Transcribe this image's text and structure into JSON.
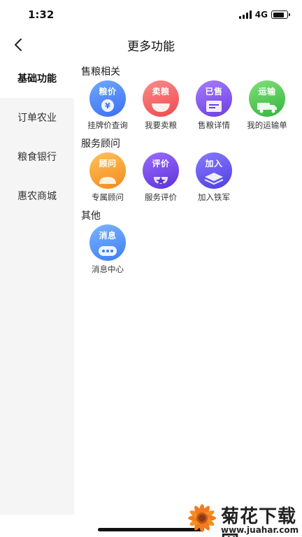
{
  "status": {
    "time": "1:32",
    "network": "4G"
  },
  "nav": {
    "title": "更多功能"
  },
  "sidebar": {
    "items": [
      {
        "label": "基础功能",
        "active": true
      },
      {
        "label": "订单农业",
        "active": false
      },
      {
        "label": "粮食银行",
        "active": false
      },
      {
        "label": "惠农商城",
        "active": false
      }
    ]
  },
  "sections": [
    {
      "title": "售粮相关",
      "items": [
        {
          "tag": "粮价",
          "label": "挂牌价查询",
          "color": "#3b6ff0",
          "icon": "yuan-coin-icon"
        },
        {
          "tag": "卖粮",
          "label": "我要卖粮",
          "color": "#ec4a4f",
          "icon": "grain-bowl-icon"
        },
        {
          "tag": "已售",
          "label": "售粮详情",
          "color": "#6b3fe0",
          "icon": "document-icon"
        },
        {
          "tag": "运输",
          "label": "我的运输单",
          "color": "#34b53d",
          "icon": "truck-icon"
        }
      ]
    },
    {
      "title": "服务顾问",
      "items": [
        {
          "tag": "顾问",
          "label": "专属顾问",
          "color": "#f28a1e",
          "icon": "person-icon"
        },
        {
          "tag": "评价",
          "label": "服务评价",
          "color": "#5d33d6",
          "icon": "star-icon"
        },
        {
          "tag": "加入",
          "label": "加入铁军",
          "color": "#4d3fe0",
          "icon": "layers-icon"
        }
      ]
    },
    {
      "title": "其他",
      "items": [
        {
          "tag": "消息",
          "label": "消息中心",
          "color": "#3d7ef2",
          "icon": "chat-bubble-icon"
        }
      ]
    }
  ],
  "watermark": {
    "text": "菊花下载网",
    "url": "www.juahar.com"
  }
}
